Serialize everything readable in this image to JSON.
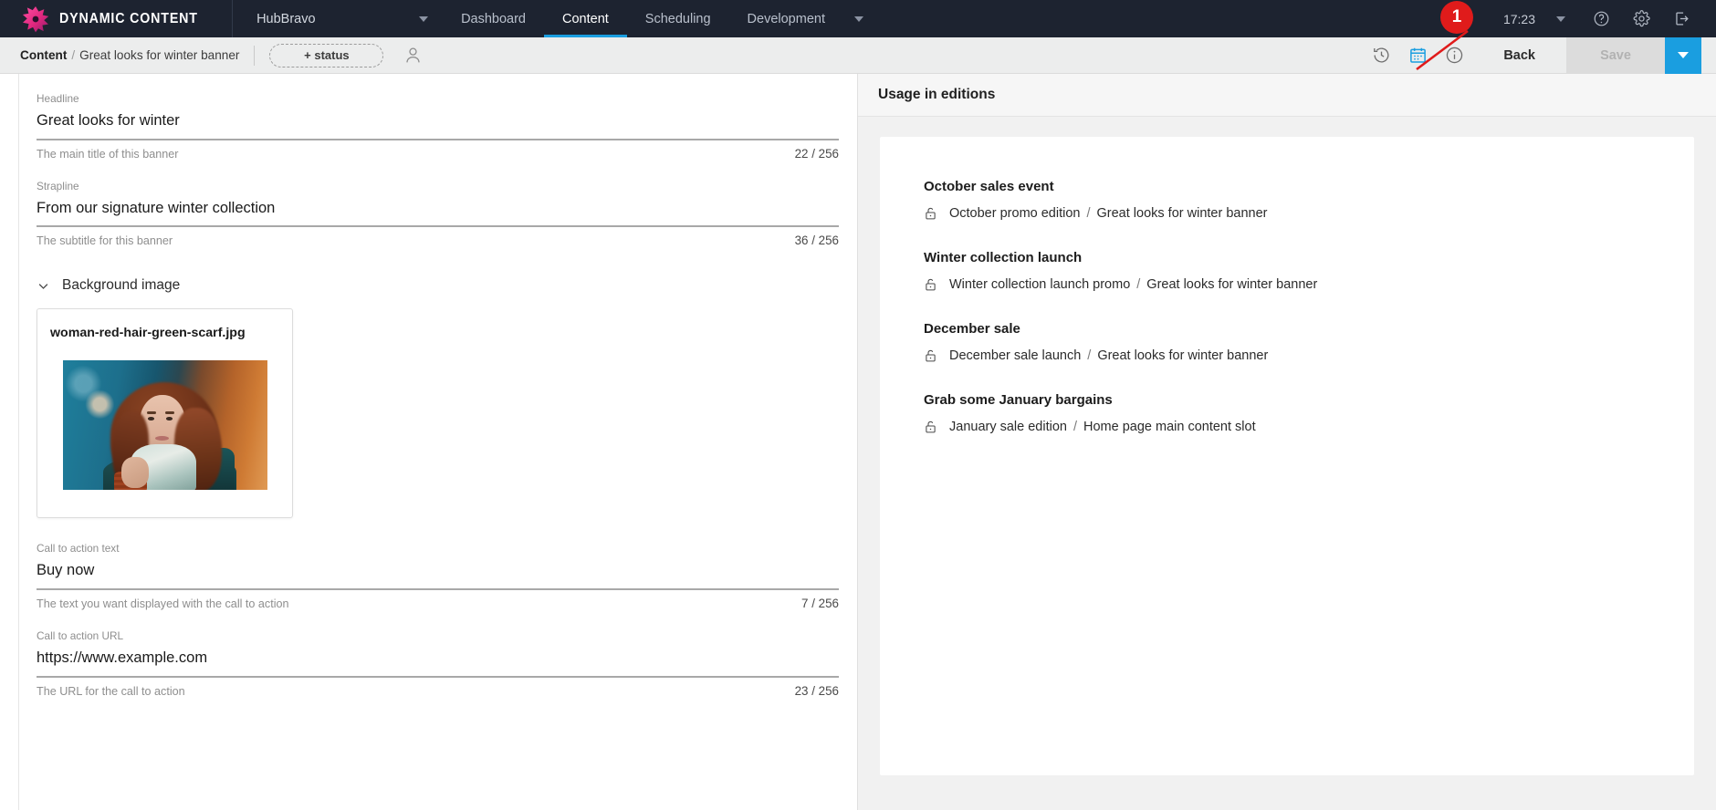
{
  "app": {
    "logo_text": "DYNAMIC CONTENT",
    "logo_icon": "starburst-logo-icon"
  },
  "topnav": {
    "hub_name": "HubBravo",
    "hub_caret_icon": "chevron-down-icon",
    "items": [
      {
        "label": "Dashboard",
        "active": false
      },
      {
        "label": "Content",
        "active": true
      },
      {
        "label": "Scheduling",
        "active": false
      },
      {
        "label": "Development",
        "active": false
      }
    ],
    "overflow_caret_icon": "chevron-down-icon",
    "annotation_badge": "1",
    "clock": "17:23",
    "clock_caret_icon": "chevron-down-icon",
    "help_icon": "question-circle-icon",
    "settings_icon": "gear-icon",
    "signout_icon": "sign-out-icon",
    "active_accent": "#1a9ee0",
    "bg": "#1d2330"
  },
  "subbar": {
    "breadcrumb_root": "Content",
    "breadcrumb_sep": "/",
    "breadcrumb_current": "Great looks for winter banner",
    "status_chip_label": "+ status",
    "avatar_icon": "user-avatar-icon",
    "history_icon": "history-clock-icon",
    "editions_icon": "calendar-editions-icon",
    "info_icon": "info-circle-icon",
    "back_label": "Back",
    "save_label": "Save",
    "save_caret_icon": "caret-down-icon",
    "save_enabled": false
  },
  "form": {
    "fields": [
      {
        "label": "Headline",
        "value": "Great looks for winter",
        "helper": "The main title of this banner",
        "counter": "22 / 256"
      },
      {
        "label": "Strapline",
        "value": "From our signature winter collection",
        "helper": "The subtitle for this banner",
        "counter": "36 / 256"
      }
    ],
    "background_section": {
      "chevron_icon": "chevron-down-icon",
      "title": "Background image",
      "image_name": "woman-red-hair-green-scarf.jpg",
      "image_alt": "woman with red hair and green scarf"
    },
    "cta_fields": [
      {
        "label": "Call to action text",
        "value": "Buy now",
        "helper": "The text you want displayed with the call to action",
        "counter": "7 / 256"
      },
      {
        "label": "Call to action URL",
        "value": "https://www.example.com",
        "helper": "The URL for the call to action",
        "counter": "23 / 256"
      }
    ]
  },
  "usage": {
    "panel_title": "Usage in editions",
    "lock_icon": "unlocked-padlock-icon",
    "separator": "/",
    "groups": [
      {
        "title": "October sales event",
        "edition": "October promo edition",
        "slot": "Great looks for winter banner"
      },
      {
        "title": "Winter collection launch",
        "edition": "Winter collection launch promo",
        "slot": "Great looks for winter banner"
      },
      {
        "title": "December sale",
        "edition": "December sale launch",
        "slot": "Great looks for winter banner"
      },
      {
        "title": "Grab some January bargains",
        "edition": "January sale edition",
        "slot": "Home page main content slot"
      }
    ]
  }
}
